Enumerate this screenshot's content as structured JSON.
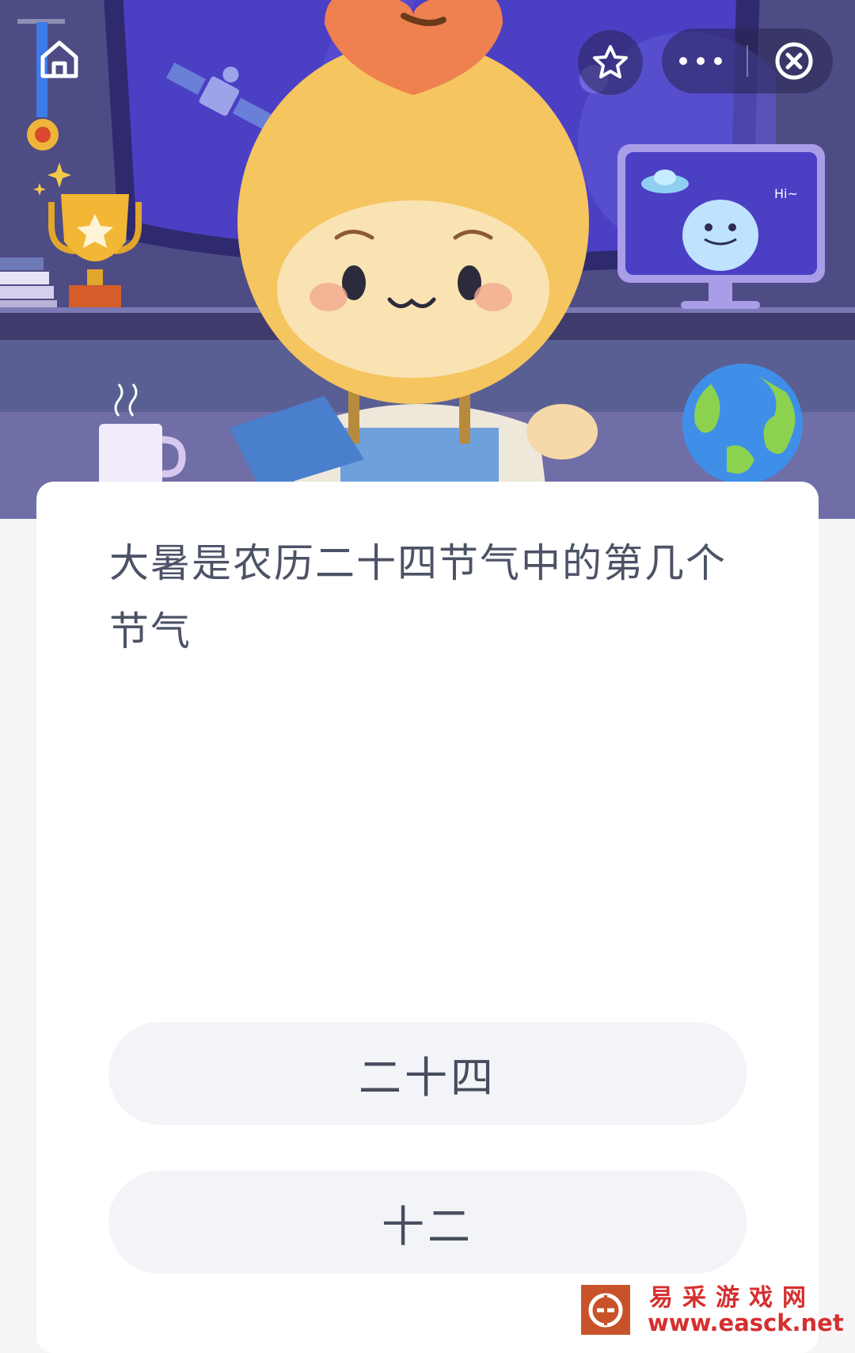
{
  "colors": {
    "question_text": "#4d5366",
    "option_bg": "#f3f4f7",
    "watermark_red": "#d62f2f"
  },
  "hero": {
    "bubble_text": "Hi~",
    "icons": [
      "medal-icon",
      "trophy-icon",
      "satellite-icon",
      "mascot-character",
      "monitor-alien",
      "coffee-cup-icon",
      "globe-icon"
    ]
  },
  "topbar": {
    "home_icon": "home-icon",
    "favorite_icon": "star-icon",
    "more_icon": "more-dots-icon",
    "close_icon": "close-circle-icon"
  },
  "quiz": {
    "question": "大暑是农历二十四节气中的第几个节气",
    "options": [
      {
        "label": "二十四"
      },
      {
        "label": "十二"
      }
    ]
  },
  "watermark": {
    "title": "易采游戏网",
    "url": "www.easck.net"
  }
}
